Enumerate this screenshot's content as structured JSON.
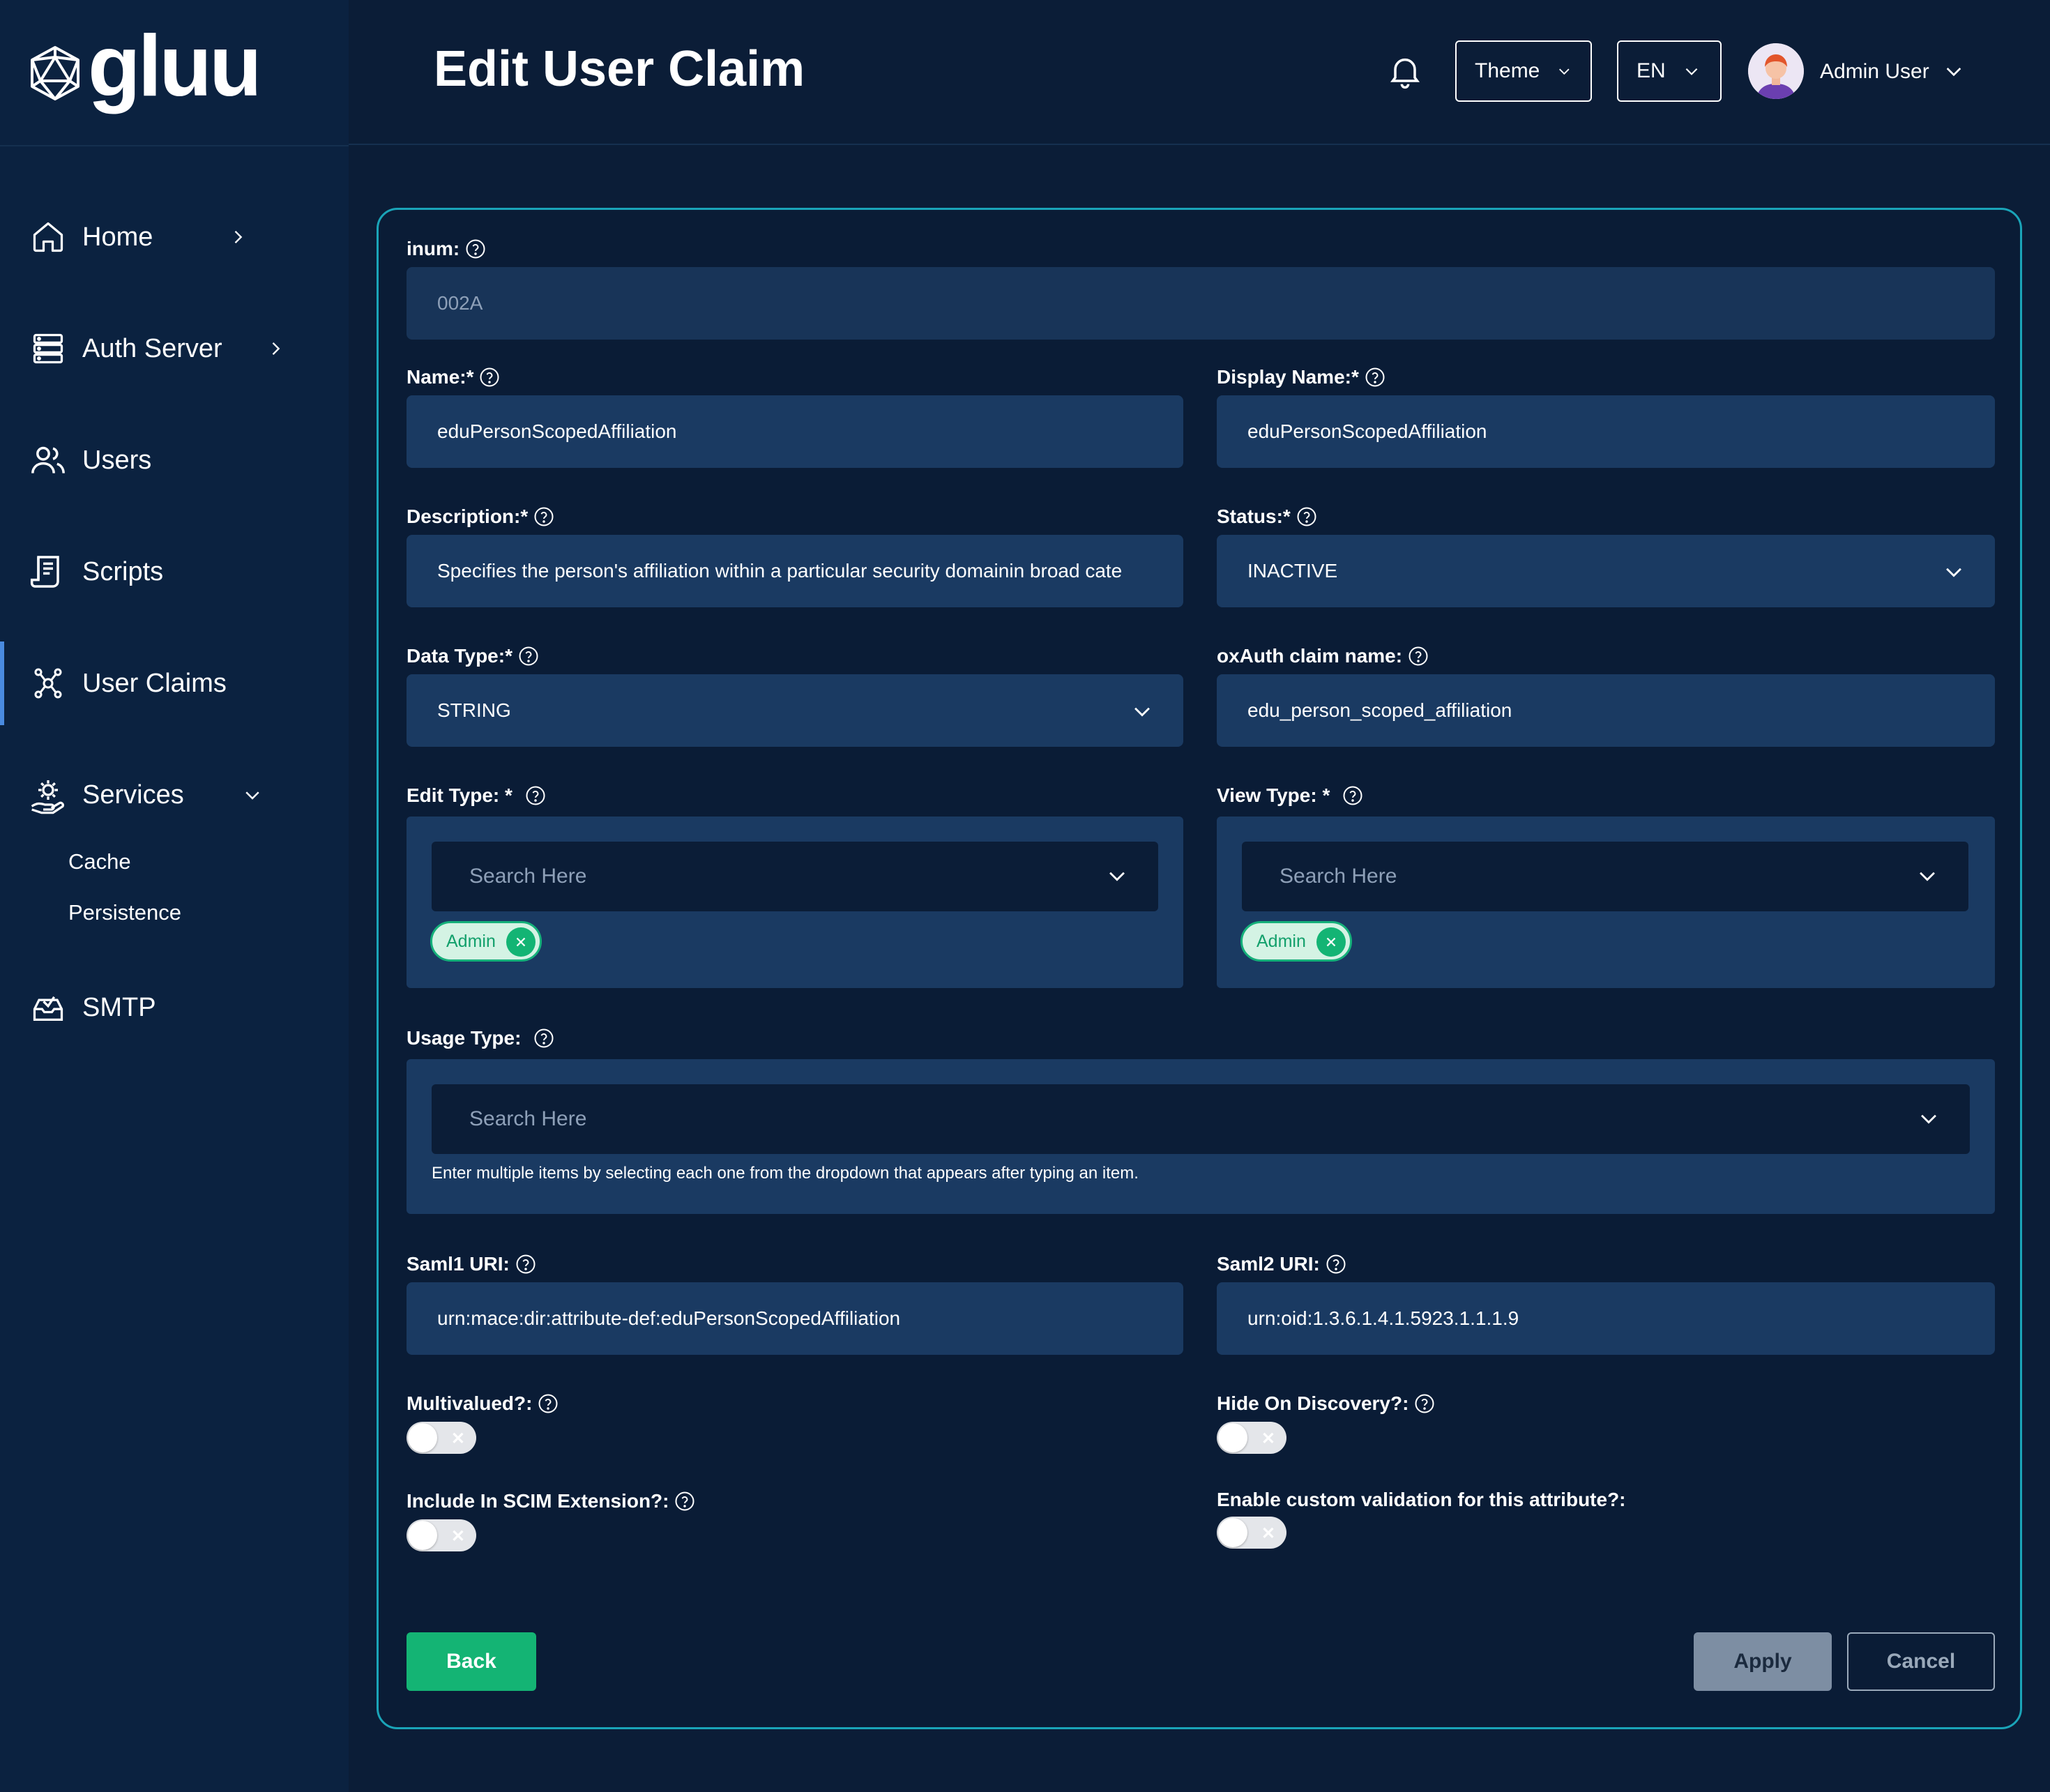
{
  "app": {
    "logo_text": "gluu"
  },
  "header": {
    "title": "Edit User Claim",
    "theme_label": "Theme",
    "lang_label": "EN",
    "user_name": "Admin User"
  },
  "sidebar": {
    "items": [
      {
        "label": "Home",
        "icon": "home-icon"
      },
      {
        "label": "Auth Server",
        "icon": "server-icon"
      },
      {
        "label": "Users",
        "icon": "users-icon"
      },
      {
        "label": "Scripts",
        "icon": "scripts-icon"
      },
      {
        "label": "User Claims",
        "icon": "claims-icon",
        "active": true
      },
      {
        "label": "Services",
        "icon": "services-icon",
        "expanded": true
      },
      {
        "label": "SMTP",
        "icon": "smtp-icon"
      }
    ],
    "services_sub": [
      "Cache",
      "Persistence"
    ]
  },
  "form": {
    "inum": {
      "label": "inum:",
      "value": "002A"
    },
    "name": {
      "label": "Name:*",
      "value": "eduPersonScopedAffiliation"
    },
    "display_name": {
      "label": "Display Name:*",
      "value": "eduPersonScopedAffiliation"
    },
    "description": {
      "label": "Description:*",
      "value": "Specifies the person's affiliation within a particular security domainin broad cate"
    },
    "status": {
      "label": "Status:*",
      "value": "INACTIVE"
    },
    "data_type": {
      "label": "Data Type:*",
      "value": "STRING"
    },
    "oxauth_claim": {
      "label": "oxAuth claim name:",
      "value": "edu_person_scoped_affiliation"
    },
    "edit_type": {
      "label": "Edit Type: *",
      "placeholder": "Search Here",
      "chips": [
        "Admin"
      ]
    },
    "view_type": {
      "label": "View Type: *",
      "placeholder": "Search Here",
      "chips": [
        "Admin"
      ]
    },
    "usage_type": {
      "label": "Usage Type:",
      "placeholder": "Search Here",
      "hint": "Enter multiple items by selecting each one from the dropdown that appears after typing an item."
    },
    "saml1": {
      "label": "Saml1 URI:",
      "value": "urn:mace:dir:attribute-def:eduPersonScopedAffiliation"
    },
    "saml2": {
      "label": "Saml2 URI:",
      "value": "urn:oid:1.3.6.1.4.1.5923.1.1.1.9"
    },
    "multivalued": {
      "label": "Multivalued?:",
      "on": false
    },
    "hide_discovery": {
      "label": "Hide On Discovery?:",
      "on": false
    },
    "scim": {
      "label": "Include In SCIM Extension?:",
      "on": false
    },
    "custom_validation": {
      "label": "Enable custom validation for this attribute?:",
      "on": false
    }
  },
  "actions": {
    "back": "Back",
    "apply": "Apply",
    "cancel": "Cancel"
  },
  "colors": {
    "accent_green": "#14b474",
    "card_border": "#1aa4b8",
    "background": "#0b1d37",
    "input_bg": "#1a3a62"
  }
}
